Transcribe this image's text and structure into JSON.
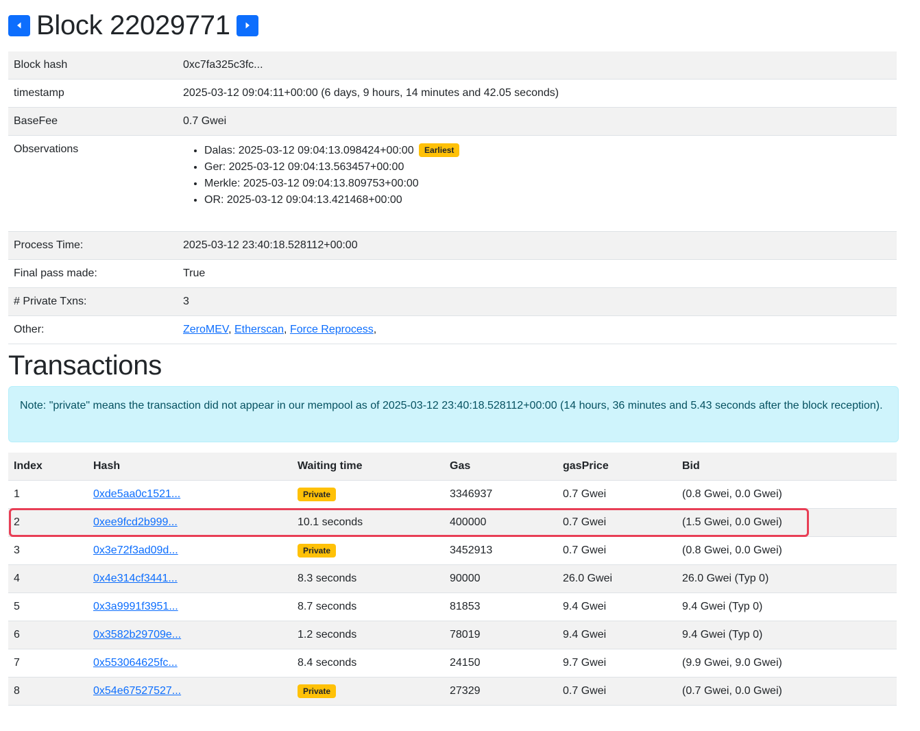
{
  "header": {
    "title": "Block 22029771",
    "prev_icon": "caret-left-icon",
    "next_icon": "caret-right-icon"
  },
  "info": {
    "block_hash_label": "Block hash",
    "block_hash_value": "0xc7fa325c3fc...",
    "timestamp_label": "timestamp",
    "timestamp_value": "2025-03-12 09:04:11+00:00 (6 days, 9 hours, 14 minutes and 42.05 seconds)",
    "basefee_label": "BaseFee",
    "basefee_value": "0.7 Gwei",
    "observations_label": "Observations",
    "observations": [
      {
        "text": "Dalas: 2025-03-12 09:04:13.098424+00:00",
        "badge": "Earliest"
      },
      {
        "text": "Ger: 2025-03-12 09:04:13.563457+00:00"
      },
      {
        "text": "Merkle: 2025-03-12 09:04:13.809753+00:00"
      },
      {
        "text": "OR: 2025-03-12 09:04:13.421468+00:00"
      }
    ],
    "process_time_label": "Process Time:",
    "process_time_value": "2025-03-12 23:40:18.528112+00:00",
    "final_pass_label": "Final pass made:",
    "final_pass_value": "True",
    "private_txns_label": "# Private Txns:",
    "private_txns_value": "3",
    "other_label": "Other:",
    "other_links": [
      "ZeroMEV",
      "Etherscan",
      "Force Reprocess"
    ],
    "other_sep": ", ",
    "other_trailing": ","
  },
  "transactions": {
    "title": "Transactions",
    "note": "Note: \"private\" means the transaction did not appear in our mempool as of 2025-03-12 23:40:18.528112+00:00 (14 hours, 36 minutes and 5.43 seconds after the block reception).",
    "columns": [
      "Index",
      "Hash",
      "Waiting time",
      "Gas",
      "gasPrice",
      "Bid"
    ],
    "rows": [
      {
        "index": "1",
        "hash": "0xde5aa0c1521...",
        "wait": "Private",
        "wait_badge": true,
        "gas": "3346937",
        "gas_price": "0.7 Gwei",
        "bid": "(0.8 Gwei, 0.0 Gwei)"
      },
      {
        "index": "2",
        "hash": "0xee9fcd2b999...",
        "wait": "10.1 seconds",
        "wait_badge": false,
        "gas": "400000",
        "gas_price": "0.7 Gwei",
        "bid": "(1.5 Gwei, 0.0 Gwei)"
      },
      {
        "index": "3",
        "hash": "0x3e72f3ad09d...",
        "wait": "Private",
        "wait_badge": true,
        "gas": "3452913",
        "gas_price": "0.7 Gwei",
        "bid": "(0.8 Gwei, 0.0 Gwei)"
      },
      {
        "index": "4",
        "hash": "0x4e314cf3441...",
        "wait": "8.3 seconds",
        "wait_badge": false,
        "gas": "90000",
        "gas_price": "26.0 Gwei",
        "bid": "26.0 Gwei (Typ 0)"
      },
      {
        "index": "5",
        "hash": "0x3a9991f3951...",
        "wait": "8.7 seconds",
        "wait_badge": false,
        "gas": "81853",
        "gas_price": "9.4 Gwei",
        "bid": "9.4 Gwei (Typ 0)"
      },
      {
        "index": "6",
        "hash": "0x3582b29709e...",
        "wait": "1.2 seconds",
        "wait_badge": false,
        "gas": "78019",
        "gas_price": "9.4 Gwei",
        "bid": "9.4 Gwei (Typ 0)"
      },
      {
        "index": "7",
        "hash": "0x553064625fc...",
        "wait": "8.4 seconds",
        "wait_badge": false,
        "gas": "24150",
        "gas_price": "9.7 Gwei",
        "bid": "(9.9 Gwei, 9.0 Gwei)"
      },
      {
        "index": "8",
        "hash": "0x54e67527527...",
        "wait": "Private",
        "wait_badge": true,
        "gas": "27329",
        "gas_price": "0.7 Gwei",
        "bid": "(0.7 Gwei, 0.0 Gwei)"
      }
    ],
    "highlighted_row_index": "2",
    "highlight_color": "#e83e55"
  },
  "colors": {
    "primary": "#0d6efd",
    "badge_warning": "#ffc107",
    "info_bg": "#cff4fc",
    "info_text": "#055160"
  }
}
